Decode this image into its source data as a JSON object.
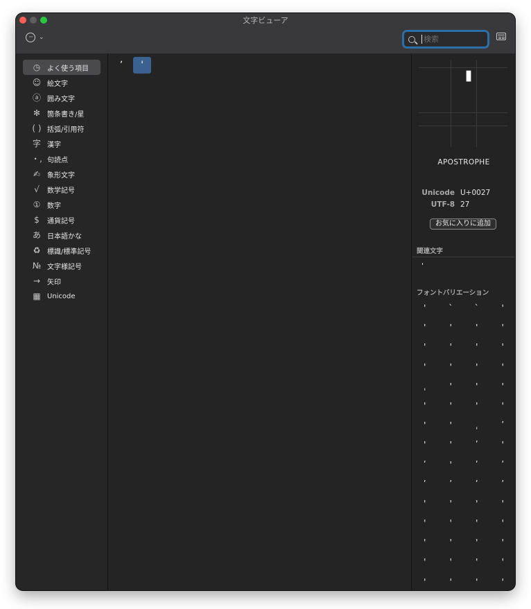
{
  "window": {
    "title": "文字ビューア"
  },
  "toolbar": {
    "menu_icon": "ellipsis-circle-icon",
    "menu_chevron": "chevron-down-icon",
    "search_placeholder": "検索",
    "search_value": "",
    "panel_icon": "character-panel-icon"
  },
  "sidebar": {
    "items": [
      {
        "icon": "◷",
        "label": "よく使う項目"
      },
      {
        "icon": "☺",
        "label": "絵文字"
      },
      {
        "icon": "ⓐ",
        "label": "囲み文字"
      },
      {
        "icon": "✻",
        "label": "箇条書き/星"
      },
      {
        "icon": "( )",
        "label": "括弧/引用符"
      },
      {
        "icon": "字",
        "label": "漢字"
      },
      {
        "icon": "・,",
        "label": "句読点"
      },
      {
        "icon": "✍",
        "label": "象形文字"
      },
      {
        "icon": "√",
        "label": "数学記号"
      },
      {
        "icon": "①",
        "label": "数字"
      },
      {
        "icon": "$",
        "label": "通貨記号"
      },
      {
        "icon": "あ",
        "label": "日本語かな"
      },
      {
        "icon": "♻",
        "label": "標識/標準記号"
      },
      {
        "icon": "№",
        "label": "文字様記号"
      },
      {
        "icon": "→",
        "label": "矢印"
      },
      {
        "icon": "▦",
        "label": "Unicode"
      }
    ]
  },
  "grid": {
    "cells": [
      "ʼ",
      "'"
    ],
    "selected_index": 1
  },
  "inspector": {
    "glyph": "'",
    "name": "APOSTROPHE",
    "unicode_label": "Unicode",
    "unicode_value": "U+0027",
    "utf8_label": "UTF-8",
    "utf8_value": "27",
    "favorite_button": "お気に入りに追加",
    "related_heading": "関連文字",
    "related": [
      "'"
    ],
    "variations_heading": "フォントバリエーション",
    "variations": [
      [
        "'",
        "ˋ",
        "ˋ",
        "'"
      ],
      [
        "'",
        "'",
        "'",
        "'"
      ],
      [
        "'",
        "'",
        "'",
        "'"
      ],
      [
        "'",
        "'",
        "'",
        "'"
      ],
      [
        "ˌ",
        "'",
        "'",
        "'"
      ],
      [
        "'",
        "'",
        "'",
        "'"
      ],
      [
        "'",
        "'",
        "ˌ",
        "ʹ"
      ],
      [
        "'",
        "'",
        "ʹ",
        "'"
      ],
      [
        "ʹ",
        "'",
        "ʹ",
        "ʹ"
      ],
      [
        "ʹ",
        "ʹ",
        "ʹ",
        "ʹ"
      ],
      [
        "'",
        "'",
        "'",
        "'"
      ],
      [
        "'",
        "'",
        "'",
        "'"
      ],
      [
        "'",
        "'",
        "'",
        "'"
      ],
      [
        "'",
        "'",
        "'",
        "'"
      ],
      [
        "'",
        "'",
        "'",
        "'"
      ],
      [
        "'",
        "ʹ",
        "'",
        "'"
      ]
    ]
  },
  "colors": {
    "accent": "#2b6fa8",
    "selection": "#3a6190",
    "background": "#252526"
  }
}
